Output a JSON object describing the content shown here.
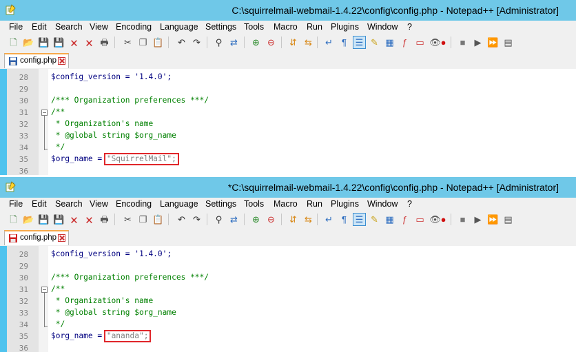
{
  "panes": [
    {
      "title": "C:\\squirrelmail-webmail-1.4.22\\config\\config.php - Notepad++ [Administrator]",
      "tab_label": "config.php",
      "tab_icon": "saved-file-icon",
      "org_name_value": "\"SquirrelMail\";"
    },
    {
      "title": "*C:\\squirrelmail-webmail-1.4.22\\config\\config.php - Notepad++ [Administrator]",
      "tab_label": "config.php",
      "tab_icon": "unsaved-file-icon",
      "org_name_value": "\"ananda\";"
    }
  ],
  "menu": [
    "File",
    "Edit",
    "Search",
    "View",
    "Encoding",
    "Language",
    "Settings",
    "Tools",
    "Macro",
    "Run",
    "Plugins",
    "Window",
    "?"
  ],
  "toolbar_icons": [
    "new-file-icon",
    "open-file-icon",
    "save-icon",
    "save-all-icon",
    "close-icon",
    "close-all-icon",
    "print-icon",
    "cut-icon",
    "copy-icon",
    "paste-icon",
    "undo-icon",
    "redo-icon",
    "find-icon",
    "replace-icon",
    "zoom-in-icon",
    "zoom-out-icon",
    "sync-vertical-icon",
    "sync-horizontal-icon",
    "word-wrap-icon",
    "show-all-chars-icon",
    "indent-guide-icon",
    "udl-icon",
    "doc-map-icon",
    "function-list-icon",
    "folder-workspace-icon",
    "monitoring-icon",
    "record-macro-icon",
    "stop-record-icon",
    "play-macro-icon",
    "run-macro-multiple-icon",
    "save-macro-icon"
  ],
  "code_lines": [
    {
      "num": "28",
      "text": "$config_version = '1.4.0';",
      "type": "code"
    },
    {
      "num": "29",
      "text": "",
      "type": "code"
    },
    {
      "num": "30",
      "text": "/*** Organization preferences ***/",
      "type": "comment"
    },
    {
      "num": "31",
      "text": "/**",
      "type": "comment"
    },
    {
      "num": "32",
      "text": " * Organization's name",
      "type": "comment"
    },
    {
      "num": "33",
      "text": " * @global string $org_name",
      "type": "comment"
    },
    {
      "num": "34",
      "text": " */",
      "type": "comment"
    },
    {
      "num": "35",
      "text": "$org_name = ",
      "type": "code"
    },
    {
      "num": "36",
      "text": "",
      "type": "code"
    }
  ],
  "colors": {
    "titlebar": "#6fc8e8",
    "editor_frame": "#4fc3ee",
    "highlight": "#e0262a",
    "comment": "#008000",
    "variable": "#000080",
    "string": "#808080",
    "tab_accent": "#f7a94b"
  }
}
